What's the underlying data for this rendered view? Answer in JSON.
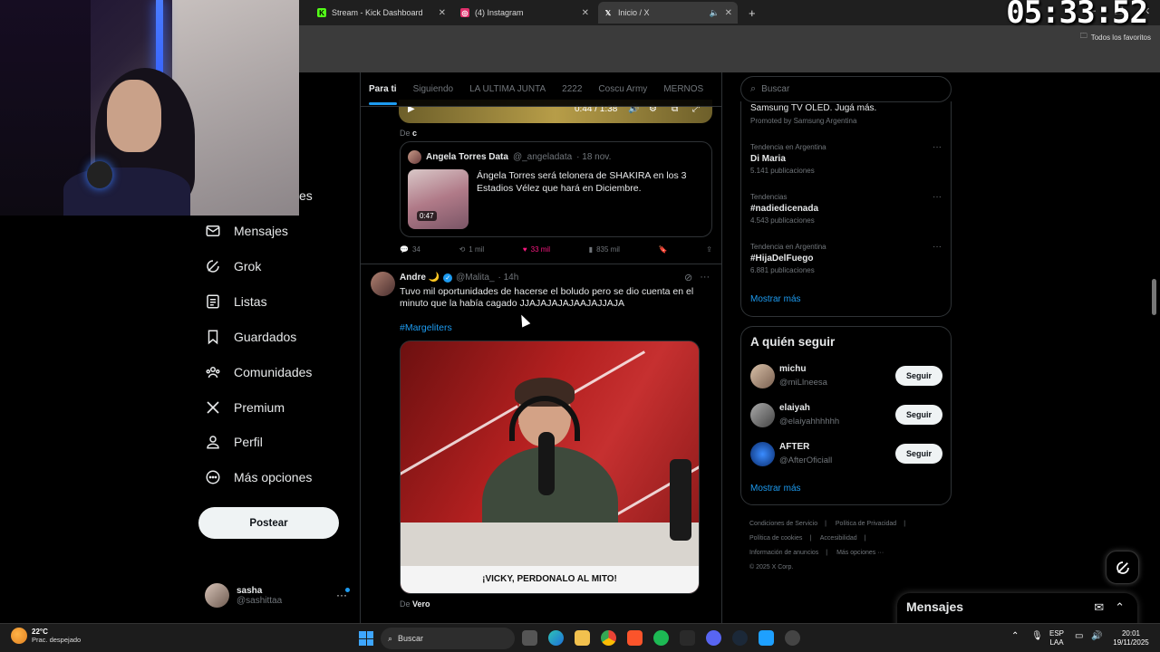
{
  "browser": {
    "tabs": [
      {
        "label": "Stream - Kick Dashboard",
        "icon": "kick-icon",
        "color": "#53fc18"
      },
      {
        "label": "(4) Instagram",
        "icon": "instagram-icon",
        "color": "#e1306c"
      },
      {
        "label": "Inicio / X",
        "icon": "x-icon",
        "color": "#ffffff"
      }
    ],
    "new_tab": "+",
    "favorites": "Todos los favoritos"
  },
  "overlay": {
    "clock": "05:33:52"
  },
  "nav": {
    "peek_label": "es",
    "items": [
      {
        "label": "Mensajes",
        "icon": "mail-icon"
      },
      {
        "label": "Grok",
        "icon": "grok-icon"
      },
      {
        "label": "Listas",
        "icon": "list-icon"
      },
      {
        "label": "Guardados",
        "icon": "bookmark-icon"
      },
      {
        "label": "Comunidades",
        "icon": "communities-icon"
      },
      {
        "label": "Premium",
        "icon": "x-logo-icon"
      },
      {
        "label": "Perfil",
        "icon": "person-icon"
      },
      {
        "label": "Más opciones",
        "icon": "more-circle-icon"
      }
    ],
    "post_button": "Postear",
    "profile": {
      "name": "sasha",
      "handle": "@sashittaa",
      "more": "···"
    }
  },
  "feed": {
    "tabs": [
      {
        "label": "Para ti",
        "active": true
      },
      {
        "label": "Siguiendo",
        "active": false
      },
      {
        "label": "LA ULTIMA JUNTA",
        "active": false
      },
      {
        "label": "2222",
        "active": false
      },
      {
        "label": "Coscu Army",
        "active": false
      },
      {
        "label": "MERNOS",
        "active": false
      }
    ],
    "video_time": "0:44 / 1:38",
    "post1": {
      "from_prefix": "De",
      "from_name": "c",
      "quote": {
        "name": "Angela Torres Data",
        "handle": "@_angeladata",
        "date": "· 18 nov.",
        "text": "Ángela Torres será telonera de SHAKIRA en los 3 Estadios Vélez que hará en Diciembre.",
        "duration": "0:47"
      },
      "replies": "34",
      "reposts": "1 mil",
      "likes": "33 mil",
      "views": "835 mil"
    },
    "post2": {
      "name": "Andre 🌙",
      "handle": "@Malita_",
      "time": "· 14h",
      "text": "Tuvo mil oportunidades de hacerse el boludo pero se dio cuenta en el minuto que la había cagado JJAJAJAJAJAAJAJJAJA",
      "hashtag": "#Margeliters",
      "caption": "¡VICKY, PERDONALO AL MITO!",
      "from_prefix": "De",
      "from_name": "Vero"
    }
  },
  "right": {
    "search_placeholder": "Buscar",
    "promo": {
      "text": "Samsung TV OLED. Jugá más.",
      "by": "Promoted by Samsung Argentina"
    },
    "trends": [
      {
        "context": "Tendencia en Argentina",
        "topic": "Di Maria",
        "count": "5.141 publicaciones"
      },
      {
        "context": "Tendencias",
        "topic": "#nadiedicenada",
        "count": "4.543 publicaciones"
      },
      {
        "context": "Tendencia en Argentina",
        "topic": "#HijaDelFuego",
        "count": "6.881 publicaciones"
      }
    ],
    "show_more": "Mostrar más",
    "follow_title": "A quién seguir",
    "follow": [
      {
        "name": "michu",
        "handle": "@miLlneesa",
        "button": "Seguir"
      },
      {
        "name": "elaiyah",
        "handle": "@elaiyahhhhhh",
        "button": "Seguir"
      },
      {
        "name": "AFTER",
        "handle": "@AfterOficiall",
        "button": "Seguir"
      }
    ],
    "follow_more": "Mostrar más",
    "footer": [
      "Condiciones de Servicio",
      "|",
      "Política de Privacidad",
      "|",
      "Política de cookies",
      "|",
      "Accesibilidad",
      "|",
      "Información de anuncios",
      "|",
      "Más opciones ···",
      "© 2025 X Corp."
    ]
  },
  "messages_drawer": {
    "title": "Mensajes"
  },
  "taskbar": {
    "weather_temp": "22°C",
    "weather_cond": "Prac. despejado",
    "search": "Buscar",
    "lang": "ESP",
    "lang2": "LAA",
    "time": "20:01",
    "date": "19/11/2025"
  }
}
